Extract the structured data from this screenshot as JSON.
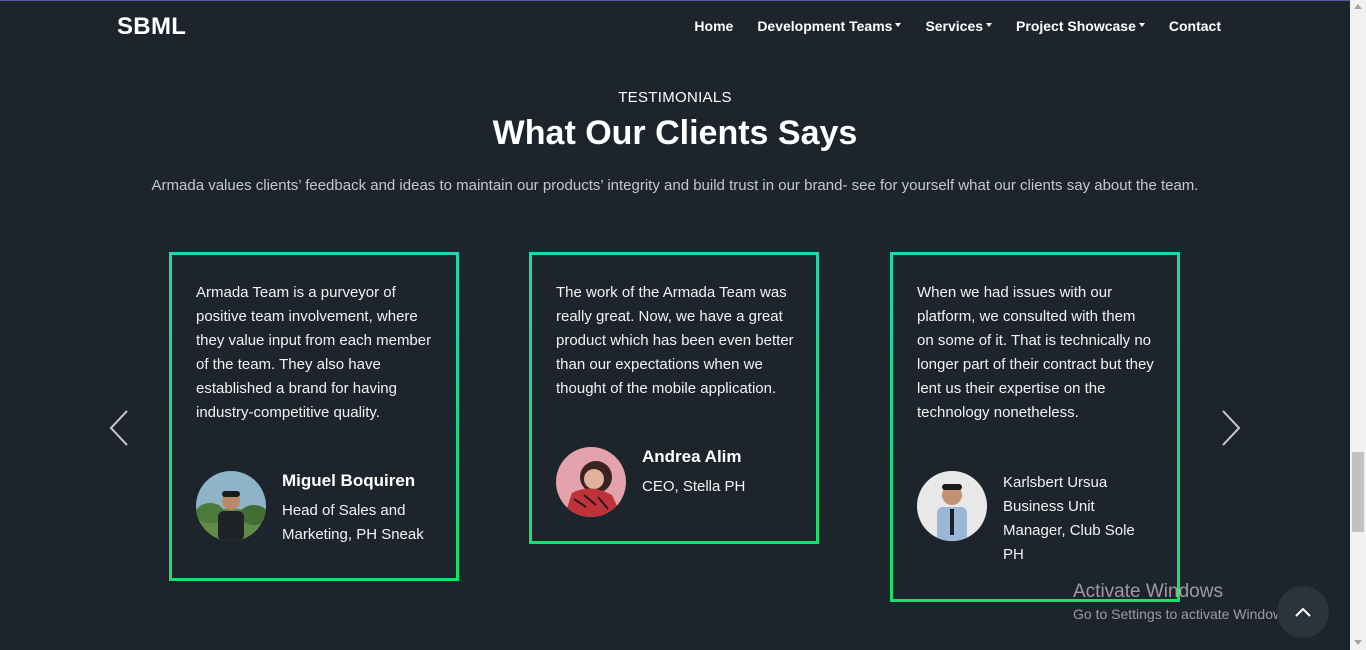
{
  "navbar": {
    "brand": "SBML",
    "items": [
      {
        "label": "Home",
        "dropdown": false
      },
      {
        "label": "Development Teams",
        "dropdown": true
      },
      {
        "label": "Services",
        "dropdown": true
      },
      {
        "label": "Project Showcase",
        "dropdown": true
      },
      {
        "label": "Contact",
        "dropdown": false
      }
    ]
  },
  "section": {
    "eyebrow": "TESTIMONIALS",
    "title": "What Our Clients Says",
    "subtitle": "Armada values clients’ feedback and ideas to maintain our products’ integrity and build trust in our brand- see for yourself what our clients say about the team."
  },
  "testimonials": [
    {
      "text": "Armada Team is a purveyor of positive team involvement, where they value input from each member of the team. They also have established a brand for having industry-competitive quality.",
      "name": "Miguel Boquiren",
      "role": "Head of Sales and Marketing, PH Sneak"
    },
    {
      "text": "The work of the Armada Team was really great. Now, we have a great product which has been even better than our expectations when we thought of the mobile application.",
      "name": "Andrea Alim",
      "role": "CEO, Stella PH"
    },
    {
      "text": "When we had issues with our platform, we consulted with them on some of it. That is technically no longer part of their contract but they lent us their expertise on the technology nonetheless.",
      "lines": [
        "Karlsbert Ursua",
        "Business Unit",
        "Manager, Club Sole",
        "PH"
      ]
    }
  ],
  "watermark": {
    "title": "Activate Windows",
    "subtitle": "Go to Settings to activate Windows."
  },
  "colors": {
    "background": "#1d242c",
    "card_border_top": "#1fd6b4",
    "card_border_bottom": "#18e06c",
    "text": "#ffffff",
    "muted_text": "#c4c9ce"
  },
  "icons": {
    "prev": "chevron-left-icon",
    "next": "chevron-right-icon",
    "back_to_top": "chevron-up-icon"
  }
}
